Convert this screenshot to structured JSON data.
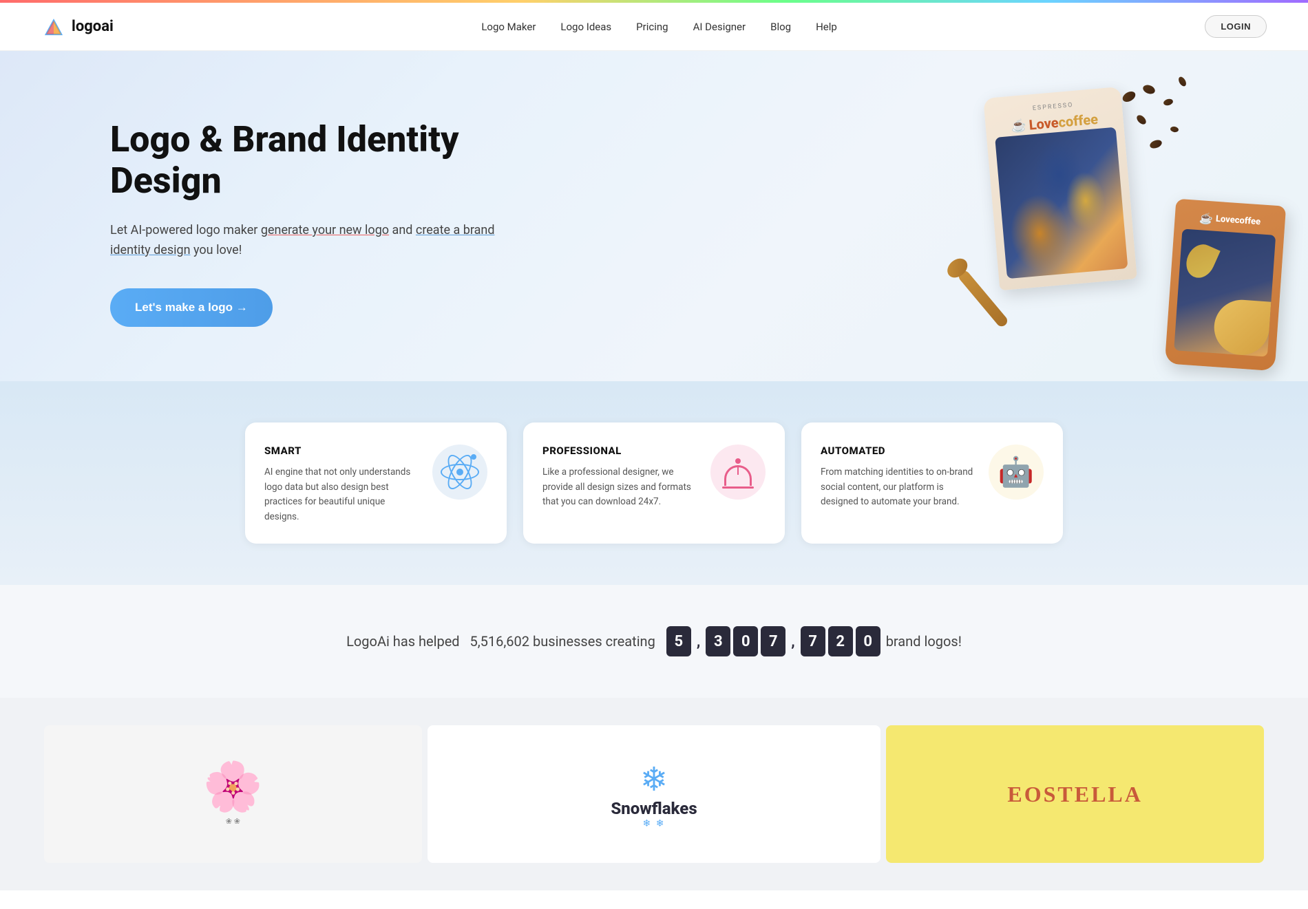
{
  "topbar": {
    "gradient": "rainbow"
  },
  "nav": {
    "logo_text": "logoai",
    "links": [
      {
        "label": "Logo Maker",
        "id": "logo-maker"
      },
      {
        "label": "Logo Ideas",
        "id": "logo-ideas"
      },
      {
        "label": "Pricing",
        "id": "pricing"
      },
      {
        "label": "AI Designer",
        "id": "ai-designer"
      },
      {
        "label": "Blog",
        "id": "blog"
      },
      {
        "label": "Help",
        "id": "help"
      }
    ],
    "login_label": "LOGIN"
  },
  "hero": {
    "title": "Logo & Brand Identity Design",
    "subtitle_part1": "Let AI-powered logo maker ",
    "subtitle_link1": "generate your new logo",
    "subtitle_part2": " and ",
    "subtitle_link2": "create a brand identity design",
    "subtitle_part3": " you love!",
    "cta_label": "Let's make a logo →"
  },
  "features": [
    {
      "id": "smart",
      "title": "SMART",
      "desc": "AI engine that not only understands logo data but also design best practices for beautiful unique designs.",
      "icon": "react"
    },
    {
      "id": "professional",
      "title": "PROFESSIONAL",
      "desc": "Like a professional designer, we provide all design sizes and formats that you can download 24x7.",
      "icon": "bell"
    },
    {
      "id": "automated",
      "title": "AUTOMATED",
      "desc": "From matching identities to on-brand social content, our platform is designed to automate your brand.",
      "icon": "robot"
    }
  ],
  "stats": {
    "text_before": "LogoAi has helped  5,516,602 businesses creating",
    "counter_digits": [
      "5",
      "3",
      "0",
      "7",
      "7",
      "2",
      "0"
    ],
    "counter_display": "5,307,720",
    "text_after": "brand logos!"
  },
  "logo_samples": [
    {
      "id": "flower",
      "bg": "#ffffff"
    },
    {
      "id": "snowflakes",
      "bg": "#ffffff",
      "name": "Snowflakes"
    },
    {
      "id": "eostella",
      "bg": "#f5e870",
      "name": "EOSTELLA"
    }
  ]
}
